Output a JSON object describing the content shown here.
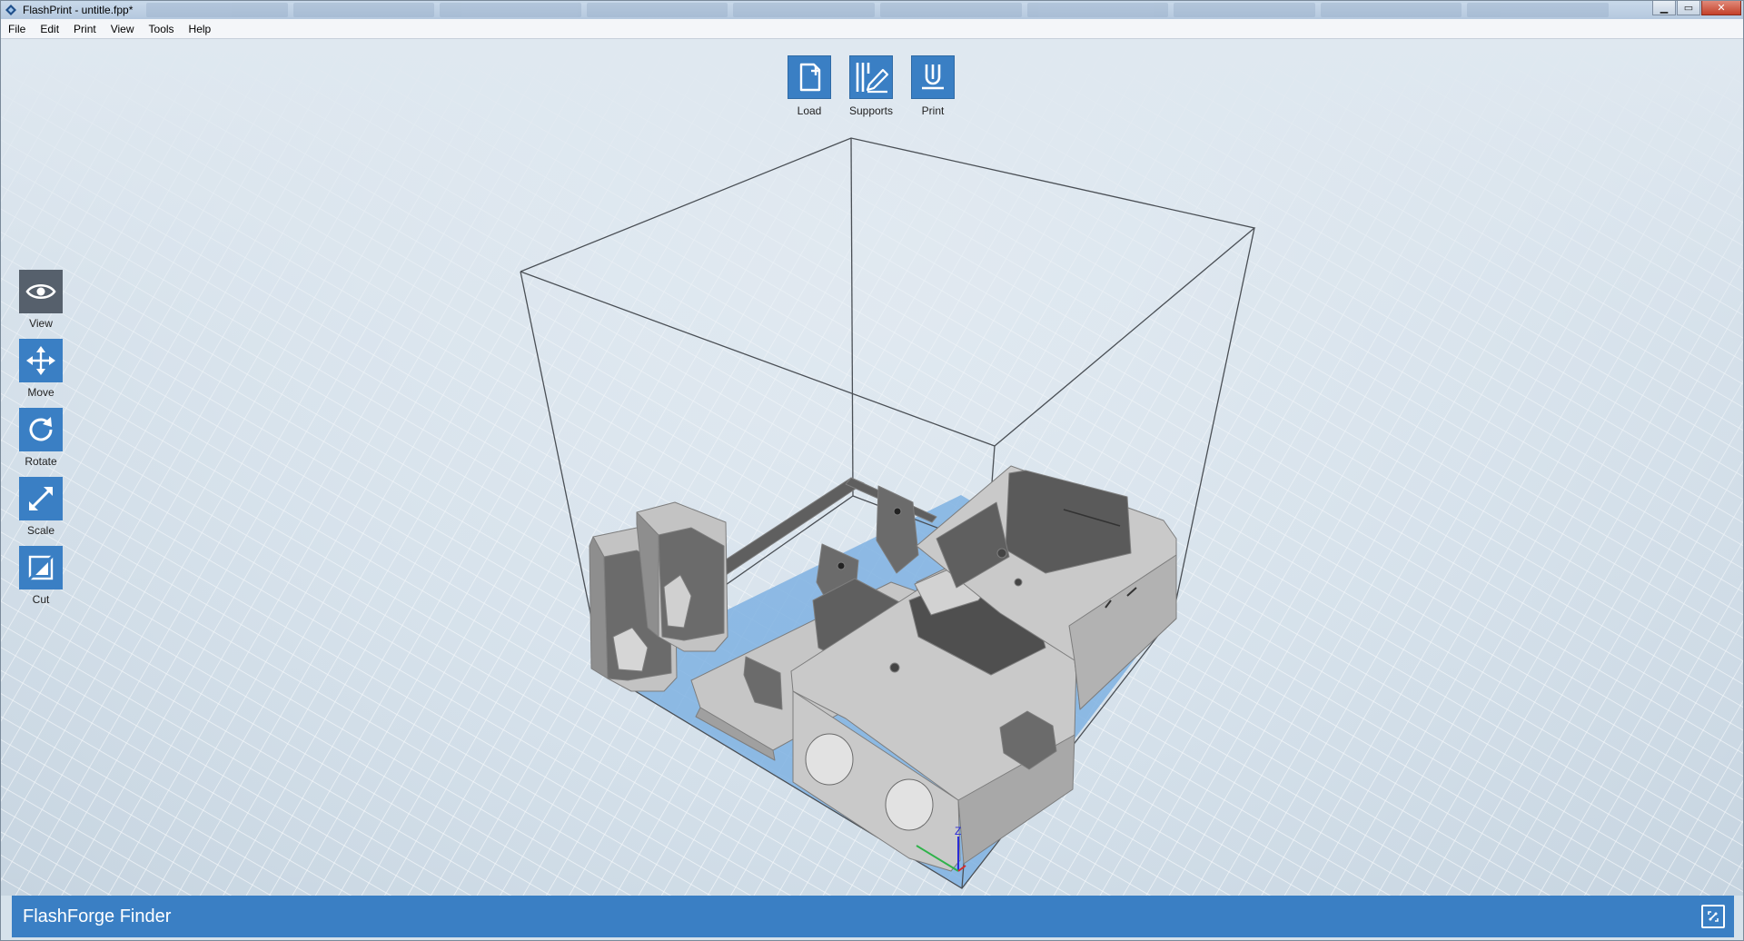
{
  "window": {
    "title": "FlashPrint - untitle.fpp*",
    "controls": {
      "minimize": "▁",
      "maximize": "▭",
      "close": "✕"
    }
  },
  "menu": {
    "items": [
      "File",
      "Edit",
      "Print",
      "View",
      "Tools",
      "Help"
    ]
  },
  "top_toolbar": {
    "load_label": "Load",
    "supports_label": "Supports",
    "print_label": "Print"
  },
  "left_toolbar": {
    "view_label": "View",
    "move_label": "Move",
    "rotate_label": "Rotate",
    "scale_label": "Scale",
    "cut_label": "Cut",
    "active": "View"
  },
  "scene": {
    "axis_label_z": "Z"
  },
  "status": {
    "device_name": "FlashForge Finder"
  },
  "colors": {
    "accent": "#3a7fc4",
    "active_tool": "#56606c",
    "model": "#bfbfbf",
    "model_dark": "#5f5f5f",
    "build_plate": "#6fa3d8"
  }
}
